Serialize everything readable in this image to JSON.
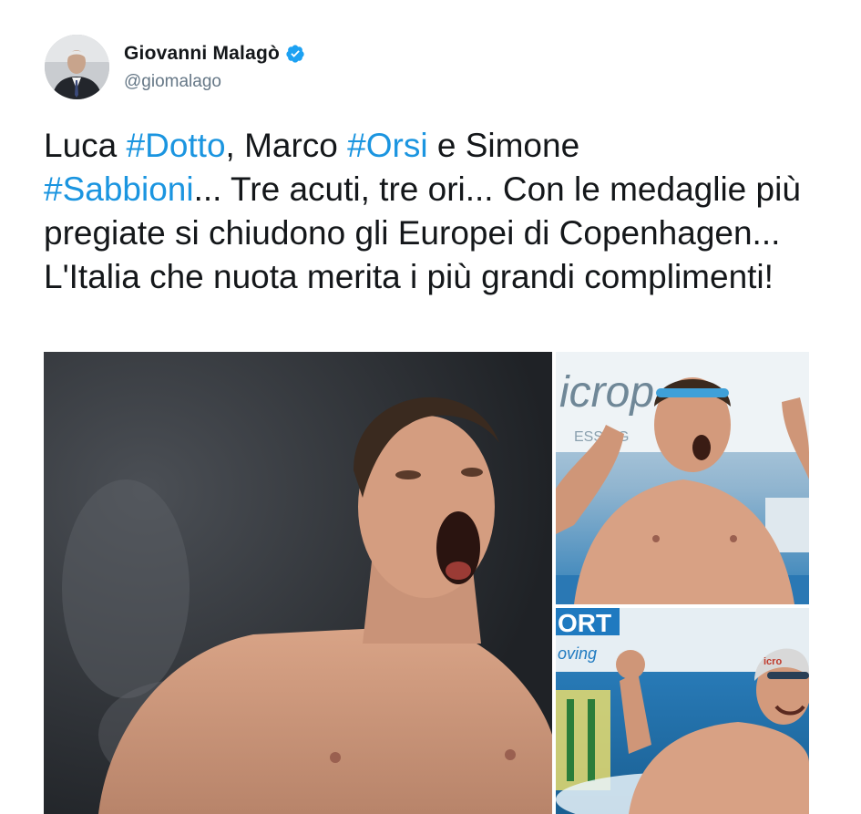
{
  "author": {
    "display_name": "Giovanni Malagò",
    "handle": "@giomalago",
    "verified": true,
    "avatar_icon": "person-portrait-avatar"
  },
  "tweet": {
    "parts": [
      {
        "text": "Luca "
      },
      {
        "text": "#Dotto"
      },
      {
        "text": ", Marco "
      },
      {
        "text": "#Orsi"
      },
      {
        "text": " e Simone "
      },
      {
        "text": "#Sabbioni"
      },
      {
        "text": "... Tre acuti, tre ori... Con le medaglie più pregiate si chiudono gli Europei di Copenhagen... L'Italia che nuota merita i più grandi complimenti!"
      }
    ]
  },
  "media": {
    "image_texts": {
      "top_right_banner": "icrop",
      "top_right_sub": "ESSING",
      "bottom_right_banner": "ORT",
      "bottom_right_sub": "oving",
      "bottom_right_cap": "icro"
    }
  },
  "colors": {
    "link": "#1b95e0",
    "text": "#14171a",
    "secondary": "#657786",
    "verified": "#1da1f2"
  }
}
